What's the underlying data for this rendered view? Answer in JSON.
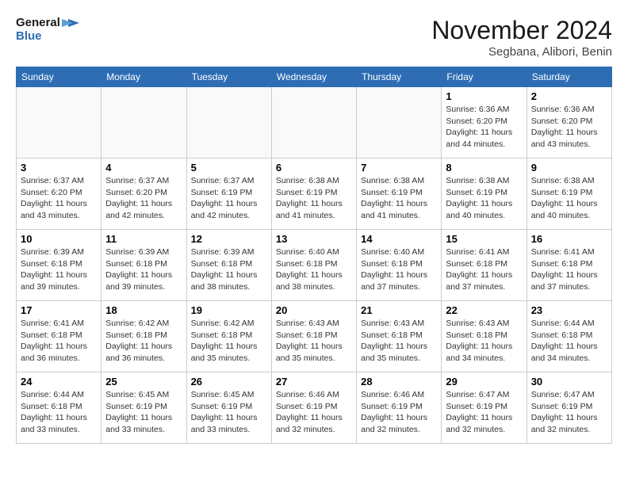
{
  "header": {
    "logo_line1": "General",
    "logo_line2": "Blue",
    "month_title": "November 2024",
    "location": "Segbana, Alibori, Benin"
  },
  "weekdays": [
    "Sunday",
    "Monday",
    "Tuesday",
    "Wednesday",
    "Thursday",
    "Friday",
    "Saturday"
  ],
  "weeks": [
    [
      {
        "day": "",
        "info": ""
      },
      {
        "day": "",
        "info": ""
      },
      {
        "day": "",
        "info": ""
      },
      {
        "day": "",
        "info": ""
      },
      {
        "day": "",
        "info": ""
      },
      {
        "day": "1",
        "info": "Sunrise: 6:36 AM\nSunset: 6:20 PM\nDaylight: 11 hours and 44 minutes."
      },
      {
        "day": "2",
        "info": "Sunrise: 6:36 AM\nSunset: 6:20 PM\nDaylight: 11 hours and 43 minutes."
      }
    ],
    [
      {
        "day": "3",
        "info": "Sunrise: 6:37 AM\nSunset: 6:20 PM\nDaylight: 11 hours and 43 minutes."
      },
      {
        "day": "4",
        "info": "Sunrise: 6:37 AM\nSunset: 6:20 PM\nDaylight: 11 hours and 42 minutes."
      },
      {
        "day": "5",
        "info": "Sunrise: 6:37 AM\nSunset: 6:19 PM\nDaylight: 11 hours and 42 minutes."
      },
      {
        "day": "6",
        "info": "Sunrise: 6:38 AM\nSunset: 6:19 PM\nDaylight: 11 hours and 41 minutes."
      },
      {
        "day": "7",
        "info": "Sunrise: 6:38 AM\nSunset: 6:19 PM\nDaylight: 11 hours and 41 minutes."
      },
      {
        "day": "8",
        "info": "Sunrise: 6:38 AM\nSunset: 6:19 PM\nDaylight: 11 hours and 40 minutes."
      },
      {
        "day": "9",
        "info": "Sunrise: 6:38 AM\nSunset: 6:19 PM\nDaylight: 11 hours and 40 minutes."
      }
    ],
    [
      {
        "day": "10",
        "info": "Sunrise: 6:39 AM\nSunset: 6:18 PM\nDaylight: 11 hours and 39 minutes."
      },
      {
        "day": "11",
        "info": "Sunrise: 6:39 AM\nSunset: 6:18 PM\nDaylight: 11 hours and 39 minutes."
      },
      {
        "day": "12",
        "info": "Sunrise: 6:39 AM\nSunset: 6:18 PM\nDaylight: 11 hours and 38 minutes."
      },
      {
        "day": "13",
        "info": "Sunrise: 6:40 AM\nSunset: 6:18 PM\nDaylight: 11 hours and 38 minutes."
      },
      {
        "day": "14",
        "info": "Sunrise: 6:40 AM\nSunset: 6:18 PM\nDaylight: 11 hours and 37 minutes."
      },
      {
        "day": "15",
        "info": "Sunrise: 6:41 AM\nSunset: 6:18 PM\nDaylight: 11 hours and 37 minutes."
      },
      {
        "day": "16",
        "info": "Sunrise: 6:41 AM\nSunset: 6:18 PM\nDaylight: 11 hours and 37 minutes."
      }
    ],
    [
      {
        "day": "17",
        "info": "Sunrise: 6:41 AM\nSunset: 6:18 PM\nDaylight: 11 hours and 36 minutes."
      },
      {
        "day": "18",
        "info": "Sunrise: 6:42 AM\nSunset: 6:18 PM\nDaylight: 11 hours and 36 minutes."
      },
      {
        "day": "19",
        "info": "Sunrise: 6:42 AM\nSunset: 6:18 PM\nDaylight: 11 hours and 35 minutes."
      },
      {
        "day": "20",
        "info": "Sunrise: 6:43 AM\nSunset: 6:18 PM\nDaylight: 11 hours and 35 minutes."
      },
      {
        "day": "21",
        "info": "Sunrise: 6:43 AM\nSunset: 6:18 PM\nDaylight: 11 hours and 35 minutes."
      },
      {
        "day": "22",
        "info": "Sunrise: 6:43 AM\nSunset: 6:18 PM\nDaylight: 11 hours and 34 minutes."
      },
      {
        "day": "23",
        "info": "Sunrise: 6:44 AM\nSunset: 6:18 PM\nDaylight: 11 hours and 34 minutes."
      }
    ],
    [
      {
        "day": "24",
        "info": "Sunrise: 6:44 AM\nSunset: 6:18 PM\nDaylight: 11 hours and 33 minutes."
      },
      {
        "day": "25",
        "info": "Sunrise: 6:45 AM\nSunset: 6:19 PM\nDaylight: 11 hours and 33 minutes."
      },
      {
        "day": "26",
        "info": "Sunrise: 6:45 AM\nSunset: 6:19 PM\nDaylight: 11 hours and 33 minutes."
      },
      {
        "day": "27",
        "info": "Sunrise: 6:46 AM\nSunset: 6:19 PM\nDaylight: 11 hours and 32 minutes."
      },
      {
        "day": "28",
        "info": "Sunrise: 6:46 AM\nSunset: 6:19 PM\nDaylight: 11 hours and 32 minutes."
      },
      {
        "day": "29",
        "info": "Sunrise: 6:47 AM\nSunset: 6:19 PM\nDaylight: 11 hours and 32 minutes."
      },
      {
        "day": "30",
        "info": "Sunrise: 6:47 AM\nSunset: 6:19 PM\nDaylight: 11 hours and 32 minutes."
      }
    ]
  ]
}
